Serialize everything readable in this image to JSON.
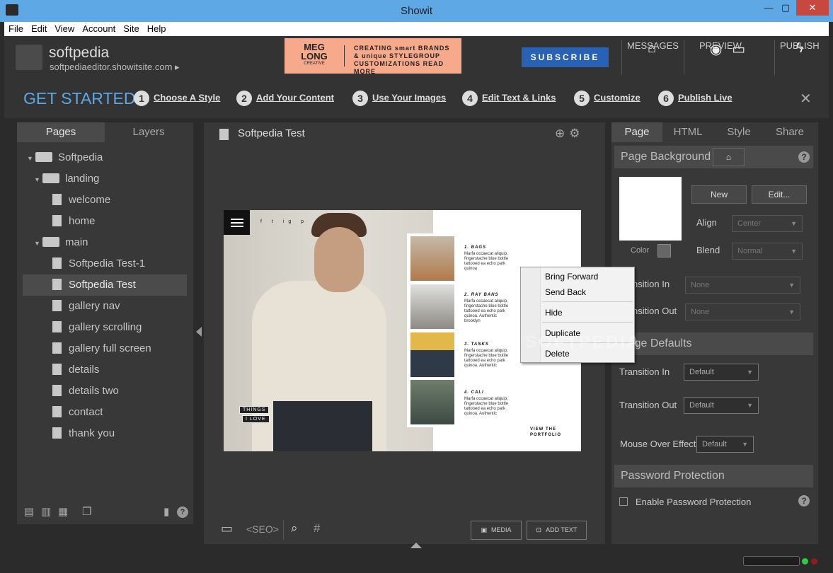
{
  "window": {
    "title": "Showit",
    "minimize": "—",
    "maximize": "▢",
    "close": "✕"
  },
  "menu": [
    "File",
    "Edit",
    "View",
    "Account",
    "Site",
    "Help"
  ],
  "site": {
    "name": "softpedia",
    "url": "softpediaeditor.showitsite.com ▸"
  },
  "banner": {
    "name_line1": "MEG",
    "name_line2": "LONG",
    "name_line3": "CREATIVE",
    "tagline1": "CREATING smart BRANDS",
    "tagline2": "& unique STYLEGROUP",
    "tagline3": "CUSTOMIZATIONS READ MORE"
  },
  "subscribe_label": "SUBSCRIBE",
  "header_buttons": {
    "messages": "MESSAGES",
    "preview": "PREVIEW",
    "publish": "PUBLISH"
  },
  "get_started": {
    "title": "GET STARTED",
    "steps": [
      {
        "num": "1",
        "label": "Choose A Style"
      },
      {
        "num": "2",
        "label": "Add Your Content"
      },
      {
        "num": "3",
        "label": "Use Your Images"
      },
      {
        "num": "4",
        "label": "Edit Text & Links"
      },
      {
        "num": "5",
        "label": "Customize"
      },
      {
        "num": "6",
        "label": "Publish Live"
      }
    ],
    "close": "✕"
  },
  "left_panel": {
    "tabs": [
      "Pages",
      "Layers"
    ],
    "tree": [
      {
        "label": "Softpedia",
        "type": "folder",
        "level": 0
      },
      {
        "label": "landing",
        "type": "folder",
        "level": 1
      },
      {
        "label": "welcome",
        "type": "home",
        "level": 2
      },
      {
        "label": "home",
        "type": "page",
        "level": 2
      },
      {
        "label": "main",
        "type": "folder",
        "level": 1
      },
      {
        "label": "Softpedia Test-1",
        "type": "page",
        "level": 2
      },
      {
        "label": "Softpedia Test",
        "type": "page",
        "level": 2,
        "selected": true
      },
      {
        "label": "gallery nav",
        "type": "page",
        "level": 2
      },
      {
        "label": "gallery scrolling",
        "type": "page",
        "level": 2
      },
      {
        "label": "gallery full screen",
        "type": "page",
        "level": 2
      },
      {
        "label": "details",
        "type": "page",
        "level": 2
      },
      {
        "label": "details two",
        "type": "page",
        "level": 2
      },
      {
        "label": "contact",
        "type": "page",
        "level": 2
      },
      {
        "label": "thank you",
        "type": "page",
        "level": 2
      }
    ]
  },
  "canvas": {
    "title": "Softpedia Test",
    "things_line1": "THINGS",
    "things_line2": "I LOVE",
    "items": [
      {
        "title": "1. BAGS",
        "body": "Marfa occaecat aliquip, fingerstache blue bottle tattooed ea echo park quinoa"
      },
      {
        "title": "2. RAY BANS",
        "body": "Marfa occaecat aliquip, fingerstache blue bottle tattooed ea echo park quinoa. Authentic brooklyn"
      },
      {
        "title": "3. TANKS",
        "body": "Marfa occaecat aliquip, fingerstache blue bottle tattooed ea echo park quinoa. Authentic"
      },
      {
        "title": "4. CALI",
        "body": "Marfa occaecat aliquip, fingerstache blue bottle tattooed ea echo park quinoa. Authentic"
      }
    ],
    "view_portfolio_line1": "VIEW THE",
    "view_portfolio_line2": "PORTFOLIO",
    "social": "f  t  ig  p"
  },
  "context_menu": [
    "Bring Forward",
    "Send Back",
    "Hide",
    "Duplicate",
    "Delete"
  ],
  "watermark": "SOFTPEDIA",
  "canvas_toolbar": {
    "seo": "<SEO>",
    "media": "MEDIA",
    "add_text": "ADD TEXT"
  },
  "right_panel": {
    "tabs": [
      "Page",
      "HTML",
      "Style",
      "Share"
    ],
    "page_background": "Page Background",
    "new_btn": "New",
    "edit_btn": "Edit...",
    "color_label": "Color",
    "align_label": "Align",
    "align_value": "Center",
    "blend_label": "Blend",
    "blend_value": "Normal",
    "transition_in_label": "Transition In",
    "transition_out_label": "Transition Out",
    "none_value": "None",
    "defaults_section": "Page Defaults",
    "default_value": "Default",
    "mouse_over_label": "Mouse Over Effect",
    "password_section": "Password Protection",
    "enable_password": "Enable Password Protection",
    "help": "?"
  },
  "colors": {
    "accent": "#5da8e5",
    "subscribe": "#2762b7",
    "titlebar": "#5fa8e6",
    "status_green": "#2ecc40",
    "status_red": "#8b1f1f"
  }
}
